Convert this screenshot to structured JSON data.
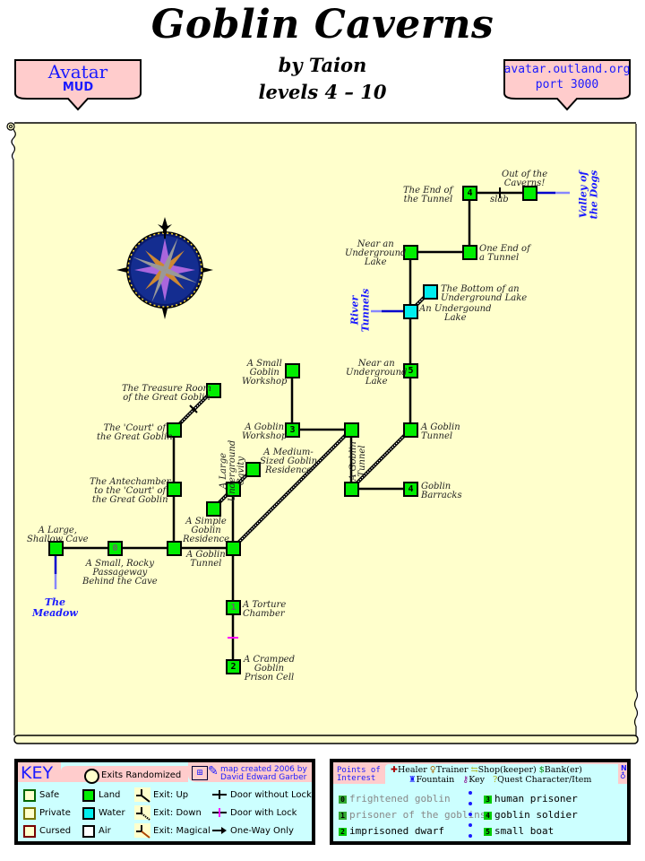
{
  "header": {
    "title": "Goblin Caverns",
    "author": "by Taion",
    "levels": "levels 4 – 10",
    "left_badge": {
      "line1": "Avatar",
      "line2": "MUD"
    },
    "right_badge": {
      "line1": "avatar.outland.org",
      "line2": "port 3000"
    }
  },
  "colors": {
    "parchment": "#ffffcc",
    "land": "#00ee00",
    "water": "#00eeee",
    "exit_label": "#1a1aff",
    "badge_bg": "#ffcccc",
    "key_bg": "#ccffff",
    "lock_door": "#ff00ff"
  },
  "map": {
    "rooms": [
      {
        "id": "end-of-tunnel",
        "label": "The End of\nthe Tunnel",
        "terrain": "land",
        "poi": "4"
      },
      {
        "id": "out-of-caverns",
        "label": "Out of the\nCaverns!",
        "terrain": "land",
        "poi": ""
      },
      {
        "id": "one-end-of-tunnel",
        "label": "One End of\na Tunnel",
        "terrain": "land",
        "poi": ""
      },
      {
        "id": "near-lake-1",
        "label": "Near an\nUnderground\nLake",
        "terrain": "land",
        "poi": ""
      },
      {
        "id": "bottom-lake",
        "label": "The Bottom of an\nUnderground Lake",
        "terrain": "water",
        "poi": ""
      },
      {
        "id": "undergound-lake",
        "label": "An Undergound\nLake",
        "terrain": "water",
        "poi": ""
      },
      {
        "id": "near-lake-2",
        "label": "Near an\nUnderground\nLake",
        "terrain": "land",
        "poi": "5"
      },
      {
        "id": "small-workshop",
        "label": "A Small\nGoblin\nWorkshop",
        "terrain": "land",
        "poi": ""
      },
      {
        "id": "goblin-workshop",
        "label": "A Goblin\nWorkshop",
        "terrain": "land",
        "poi": "3"
      },
      {
        "id": "goblin-tunnel-mid",
        "label": "A Goblin\nTunnel",
        "terrain": "land",
        "poi": ""
      },
      {
        "id": "goblin-tunnel-east",
        "label": "A Goblin\nTunnel",
        "terrain": "land",
        "poi": ""
      },
      {
        "id": "goblin-tunnel-low",
        "label": "",
        "terrain": "land",
        "poi": ""
      },
      {
        "id": "goblin-barracks",
        "label": "Goblin\nBarracks",
        "terrain": "land",
        "poi": "4"
      },
      {
        "id": "treasure-room",
        "label": "The Treasure Room\nof the Great Goblin",
        "terrain": "land",
        "poi": ""
      },
      {
        "id": "court",
        "label": "The 'Court' of\nthe Great Goblin",
        "terrain": "land",
        "poi": ""
      },
      {
        "id": "antechamber",
        "label": "The Antechamber\nto the 'Court' of\nthe Great Goblin",
        "terrain": "land",
        "poi": ""
      },
      {
        "id": "large-cavity",
        "label": "A Large\nUnderground\nCavity",
        "terrain": "land",
        "poi": ""
      },
      {
        "id": "medium-residence",
        "label": "A Medium-\nSized Goblin\nResidence",
        "terrain": "land",
        "poi": ""
      },
      {
        "id": "simple-residence",
        "label": "A Simple\nGoblin\nResidence",
        "terrain": "land",
        "poi": ""
      },
      {
        "id": "large-shallow-cave",
        "label": "A Large,\nShallow Cave",
        "terrain": "land",
        "poi": ""
      },
      {
        "id": "rocky-passageway",
        "label": "A Small, Rocky\nPassageway\nBehind the Cave",
        "terrain": "land",
        "poi": "0"
      },
      {
        "id": "junction-west",
        "label": "",
        "terrain": "land",
        "poi": ""
      },
      {
        "id": "goblin-tunnel-south",
        "label": "A Goblin\nTunnel",
        "terrain": "land",
        "poi": ""
      },
      {
        "id": "torture-chamber",
        "label": "A Torture\nChamber",
        "terrain": "land",
        "poi": "1"
      },
      {
        "id": "prison-cell",
        "label": "A Cramped\nGoblin\nPrison Cell",
        "terrain": "land",
        "poi": "2"
      }
    ],
    "door_labels": {
      "slab": "slab"
    },
    "exits": {
      "valley": "Valley of\nthe Dogs",
      "river": "River\nTunnels",
      "meadow": "The\nMeadow"
    }
  },
  "key": {
    "title": "KEY",
    "exits_randomized": "Exits Randomized",
    "credit_line1": "map created 2006 by",
    "credit_line2": "David Edward Garber",
    "zones": [
      "Safe",
      "Private",
      "Cursed"
    ],
    "terrains": [
      "Land",
      "Water",
      "Air"
    ],
    "exit_types": [
      "Exit: Up",
      "Exit: Down",
      "Exit: Magical"
    ],
    "doors": [
      "Door without Lock",
      "Door with Lock",
      "One-Way Only"
    ]
  },
  "poi": {
    "title_line1": "Points of",
    "title_line2": "Interest",
    "legend_row1": [
      "Healer",
      "Trainer",
      "Shop(keeper)",
      "Bank(er)"
    ],
    "legend_row2": [
      "Fountain",
      "Key",
      "Quest Character/Item"
    ],
    "compass": "N",
    "items": [
      {
        "num": "0",
        "text": "frightened goblin",
        "dim": true
      },
      {
        "num": "1",
        "text": "prisoner of the goblins",
        "dim": true
      },
      {
        "num": "2",
        "text": "imprisoned dwarf",
        "dim": false
      },
      {
        "num": "3",
        "text": "human prisoner",
        "dim": false
      },
      {
        "num": "4",
        "text": "goblin soldier",
        "dim": false
      },
      {
        "num": "5",
        "text": "small boat",
        "dim": false
      }
    ]
  }
}
